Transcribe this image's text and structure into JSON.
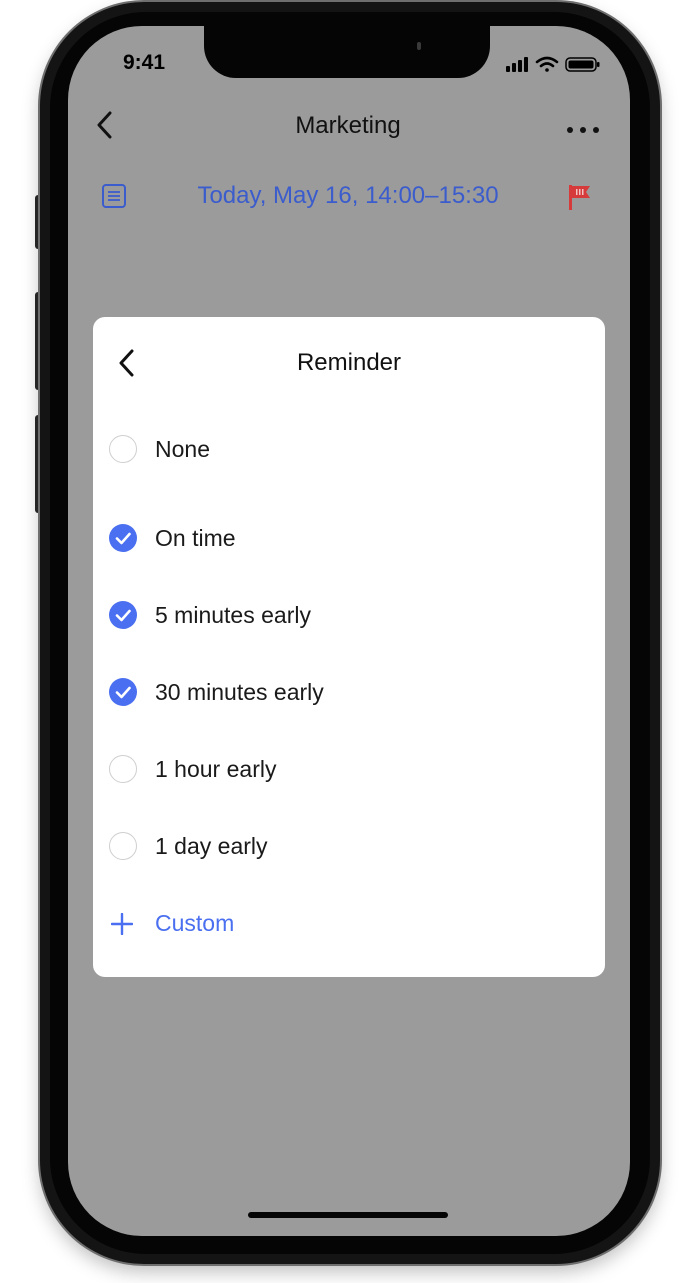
{
  "status_bar": {
    "time": "9:41",
    "icons": [
      "signal-icon",
      "wifi-icon",
      "battery-icon"
    ]
  },
  "nav": {
    "back_icon": "chevron-left-icon",
    "title": "Marketing",
    "more_icon": "more-horizontal-icon"
  },
  "event": {
    "notes_icon": "notes-icon",
    "datetime": "Today, May 16, 14:00–15:30",
    "flag_icon": "flag-icon"
  },
  "reminder_sheet": {
    "back_icon": "chevron-left-icon",
    "title": "Reminder",
    "options": [
      {
        "label": "None",
        "checked": false
      },
      {
        "label": "On time",
        "checked": true
      },
      {
        "label": "5 minutes early",
        "checked": true
      },
      {
        "label": "30 minutes early",
        "checked": true
      },
      {
        "label": "1 hour early",
        "checked": false
      },
      {
        "label": "1 day early",
        "checked": false
      }
    ],
    "custom": {
      "icon": "plus-icon",
      "label": "Custom"
    }
  },
  "colors": {
    "accent": "#4a6ff0",
    "date_text": "#3b5ccc",
    "flag": "#d63a3a",
    "overlay_background": "#9b9b9b",
    "sheet_background": "#ffffff"
  }
}
